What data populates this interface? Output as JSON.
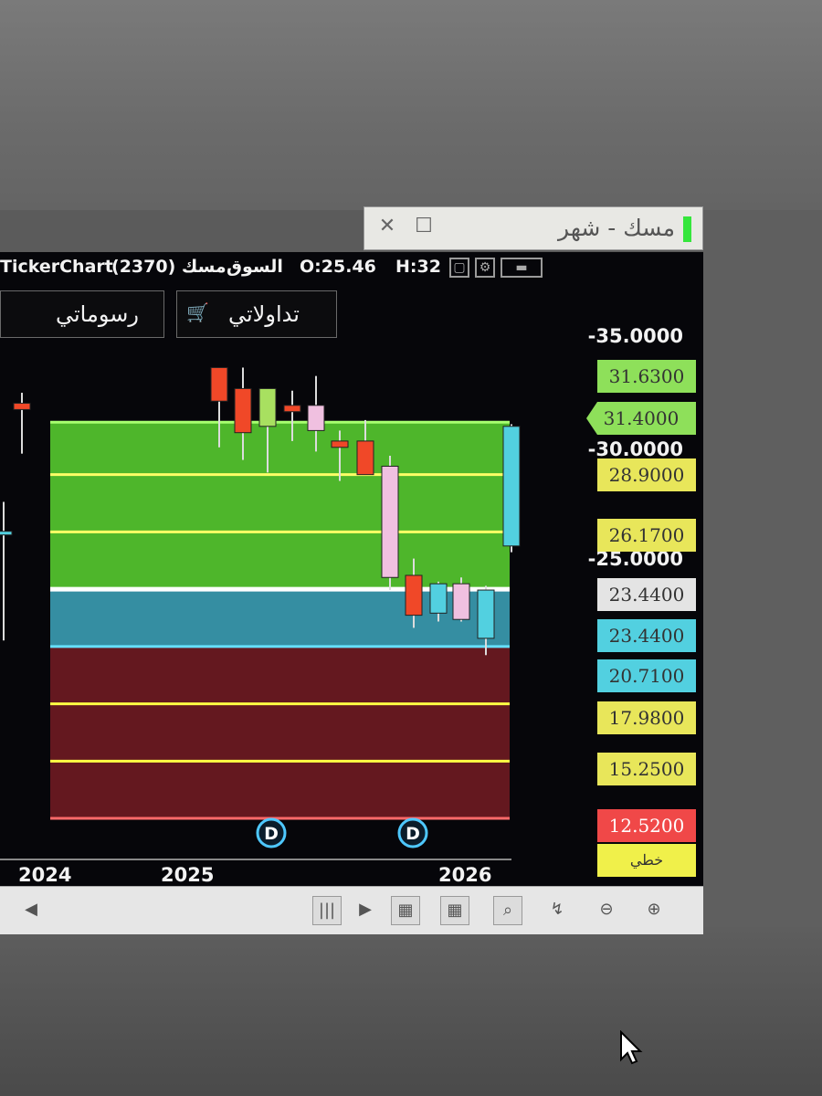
{
  "window": {
    "title": "مسك - شهر",
    "close_symbol": "✕",
    "maximize_symbol": "☐",
    "status_color": "#35e63c"
  },
  "info_bar": {
    "app": "TickerChart",
    "symbol": "مسك (2370)",
    "market": "السوق",
    "open": "O:25.46",
    "high": "H:32"
  },
  "tabs": {
    "my_drawings": "رسوماتي",
    "my_trades": "تداولاتي"
  },
  "price_axis": {
    "ticks": [
      "-35.0000",
      "-30.0000",
      "-25.0000"
    ],
    "tags": [
      {
        "label": "31.6300",
        "color": "#8ee05a"
      },
      {
        "label": "31.4000",
        "color": "#8ee05a"
      },
      {
        "label": "28.9000",
        "color": "#e8e65a"
      },
      {
        "label": "26.1700",
        "color": "#e8e65a"
      },
      {
        "label": "23.4400",
        "color": "#e4e4e4"
      },
      {
        "label": "23.4400",
        "color": "#52d0e0"
      },
      {
        "label": "20.7100",
        "color": "#52d0e0"
      },
      {
        "label": "17.9800",
        "color": "#e8e65a"
      },
      {
        "label": "15.2500",
        "color": "#e8e65a"
      },
      {
        "label": "12.5200",
        "color": "#f04848"
      }
    ],
    "extra_tag": "خطي"
  },
  "time_axis": {
    "labels": [
      "2024",
      "2025",
      "2026"
    ]
  },
  "dividend_marker": "D",
  "chart_data": {
    "type": "candlestick",
    "candles": [
      {
        "o": 26.2,
        "h": 27.6,
        "l": 21.0,
        "c": 26.1,
        "color": "#52d0e0"
      },
      {
        "o": 32.3,
        "h": 32.8,
        "l": 29.9,
        "c": 32.0,
        "color": "#f04828"
      },
      {
        "o": 32.4,
        "h": 33.5,
        "l": 30.2,
        "c": 34.0,
        "color": "#f04828"
      },
      {
        "o": 33.0,
        "h": 34.0,
        "l": 29.6,
        "c": 30.9,
        "color": "#f04828"
      },
      {
        "o": 31.2,
        "h": 32.1,
        "l": 29.0,
        "c": 33.0,
        "color": "#a8e060"
      },
      {
        "o": 32.2,
        "h": 32.9,
        "l": 30.5,
        "c": 31.9,
        "color": "#f04828"
      },
      {
        "o": 31.0,
        "h": 33.6,
        "l": 30.0,
        "c": 32.2,
        "color": "#f0c0e0"
      },
      {
        "o": 30.5,
        "h": 31.0,
        "l": 28.6,
        "c": 30.2,
        "color": "#f04828"
      },
      {
        "o": 30.5,
        "h": 31.5,
        "l": 29.3,
        "c": 28.9,
        "color": "#f04828"
      },
      {
        "o": 29.3,
        "h": 29.8,
        "l": 23.4,
        "c": 24.0,
        "color": "#f0c0e0"
      },
      {
        "o": 24.1,
        "h": 24.9,
        "l": 21.6,
        "c": 22.2,
        "color": "#f04828"
      },
      {
        "o": 22.3,
        "h": 23.8,
        "l": 21.9,
        "c": 23.7,
        "color": "#52d0e0"
      },
      {
        "o": 23.7,
        "h": 24.0,
        "l": 21.9,
        "c": 22.0,
        "color": "#f0c0e0"
      },
      {
        "o": 23.4,
        "h": 23.6,
        "l": 20.3,
        "c": 21.1,
        "color": "#52d0e0"
      },
      {
        "o": 25.5,
        "h": 31.3,
        "l": 25.2,
        "c": 31.2,
        "color": "#52d0e0"
      }
    ],
    "levels": [
      31.4,
      28.9,
      26.17,
      23.44,
      20.71,
      17.98,
      15.25,
      12.52
    ],
    "zones": [
      {
        "from": 23.44,
        "to": 31.4,
        "color": "#55c52f"
      },
      {
        "from": 20.71,
        "to": 23.44,
        "color": "#3a9ab0"
      },
      {
        "from": 12.52,
        "to": 20.71,
        "color": "#6d1a22"
      }
    ],
    "ylim": [
      12.0,
      35.5
    ]
  },
  "toolbar": {
    "tools": [
      "◀",
      "|||",
      "▶",
      "▦",
      "▦",
      "⌕",
      "↯",
      "⊖",
      "⊕"
    ]
  }
}
